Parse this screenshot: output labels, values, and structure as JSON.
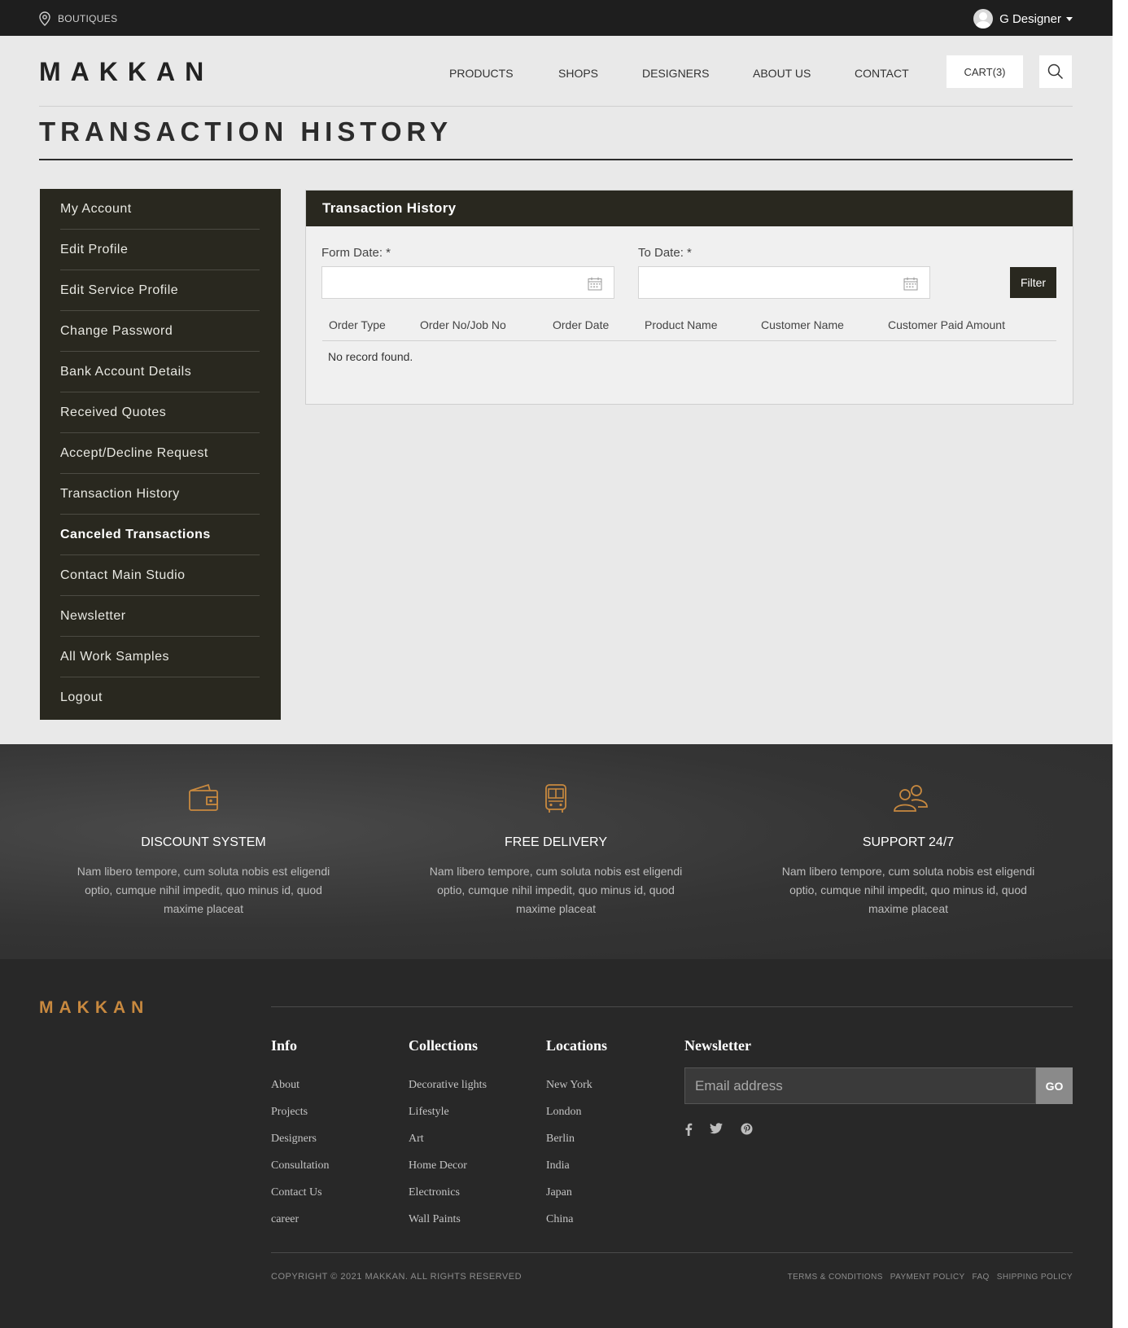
{
  "topbar": {
    "boutiques": "BOUTIQUES",
    "user_name": "G Designer"
  },
  "header": {
    "logo": "MAKKAN",
    "nav": [
      "PRODUCTS",
      "SHOPS",
      "DESIGNERS",
      "ABOUT US",
      "CONTACT"
    ],
    "cart": "CART(3)"
  },
  "page_title": "TRANSACTION HISTORY",
  "sidebar": {
    "items": [
      "My Account",
      "Edit Profile",
      "Edit Service Profile",
      "Change Password",
      "Bank Account Details",
      "Received Quotes",
      "Accept/Decline Request",
      "Transaction History",
      "Canceled Transactions",
      "Contact Main Studio",
      "Newsletter",
      "All Work Samples",
      "Logout"
    ],
    "active_item": "Canceled Transactions"
  },
  "panel": {
    "title": "Transaction History",
    "from_label": "Form Date: *",
    "to_label": "To Date: *",
    "from_value": "",
    "to_value": "",
    "filter": "Filter",
    "columns": [
      "Order Type",
      "Order No/Job No",
      "Order Date",
      "Product Name",
      "Customer Name",
      "Customer Paid Amount"
    ],
    "empty": "No record found."
  },
  "features": [
    {
      "icon": "wallet-icon",
      "title": "DISCOUNT SYSTEM",
      "desc": "Nam libero tempore, cum soluta nobis est eligendi optio, cumque nihil impedit, quo minus id, quod maxime placeat"
    },
    {
      "icon": "bus-icon",
      "title": "FREE DELIVERY",
      "desc": "Nam libero tempore, cum soluta nobis est eligendi optio, cumque nihil impedit, quo minus id, quod maxime placeat"
    },
    {
      "icon": "users-icon",
      "title": "SUPPORT 24/7",
      "desc": "Nam libero tempore, cum soluta nobis est eligendi optio, cumque nihil impedit, quo minus id, quod maxime placeat"
    }
  ],
  "footer": {
    "logo": "MAKKAN",
    "info": {
      "title": "Info",
      "links": [
        "About",
        "Projects",
        "Designers",
        "Consultation",
        "Contact Us",
        "career"
      ]
    },
    "collections": {
      "title": "Collections",
      "links": [
        "Decorative lights",
        "Lifestyle",
        "Art",
        "Home Decor",
        "Electronics",
        "Wall Paints"
      ]
    },
    "locations": {
      "title": "Locations",
      "links": [
        "New York",
        "London",
        "Berlin",
        "India",
        "Japan",
        "China"
      ]
    },
    "newsletter": {
      "title": "Newsletter",
      "placeholder": "Email address",
      "go": "GO"
    },
    "social": [
      "facebook-icon",
      "twitter-icon",
      "pinterest-icon"
    ],
    "copyright": "COPYRIGHT © 2021 MAKKAN. ALL RIGHTS RESERVED",
    "policies": [
      "TERMS & CONDITIONS",
      "PAYMENT POLICY",
      "FAQ",
      "SHIPPING POLICY"
    ]
  },
  "colors": {
    "dark": "#29281f",
    "accent": "#c8893f",
    "background": "#e9e9e9"
  }
}
